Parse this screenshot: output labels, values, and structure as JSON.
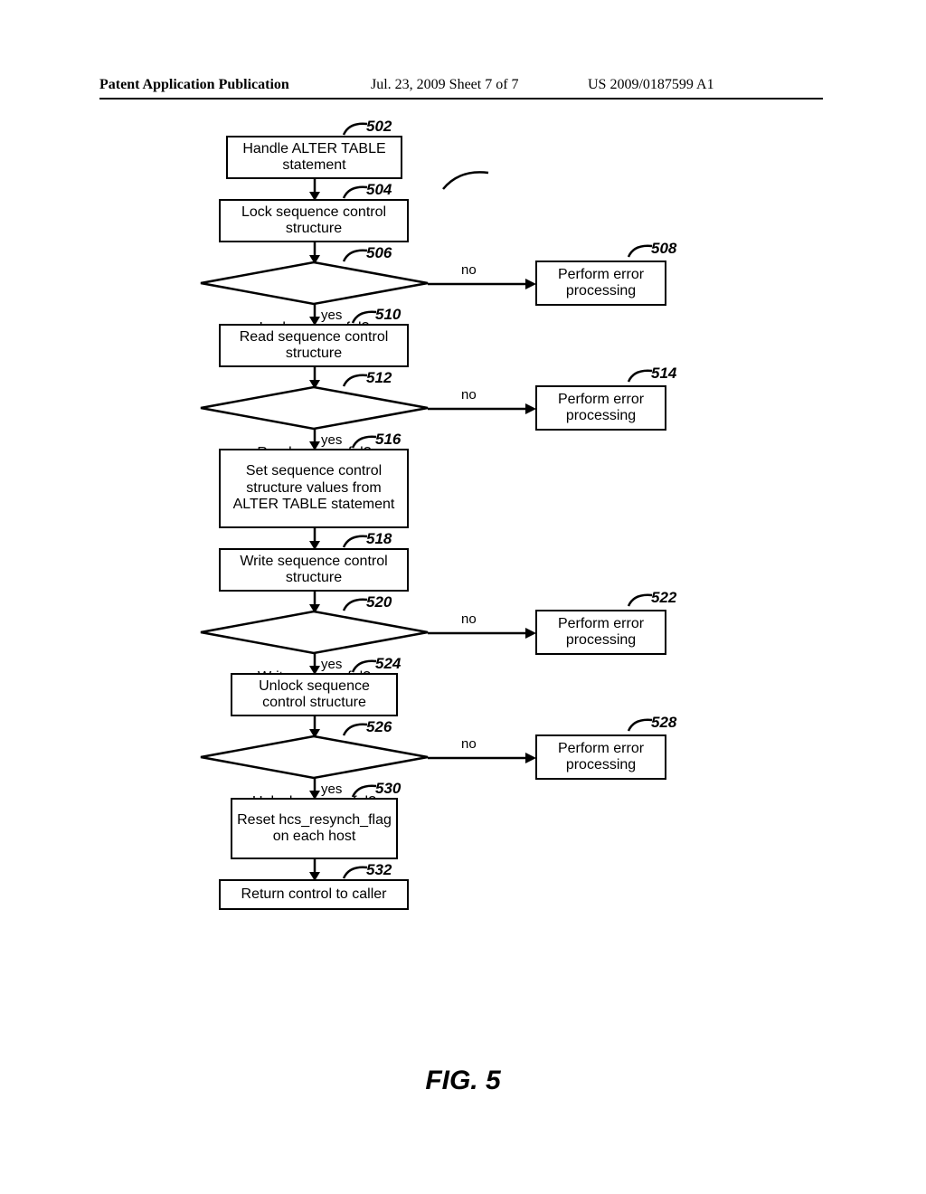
{
  "header": {
    "left": "Patent Application Publication",
    "middle": "Jul. 23, 2009   Sheet 7 of 7",
    "right": "US 2009/0187599 A1"
  },
  "figure_caption": "FIG. 5",
  "refs": {
    "r502": "502",
    "r504": "504",
    "r506": "506",
    "r508": "508",
    "r510": "510",
    "r512": "512",
    "r514": "514",
    "r516": "516",
    "r518": "518",
    "r520": "520",
    "r522": "522",
    "r524": "524",
    "r526": "526",
    "r528": "528",
    "r530": "530",
    "r532": "532"
  },
  "labels": {
    "yes": "yes",
    "no": "no"
  },
  "nodes": {
    "n502": "Handle ALTER TABLE statement",
    "n504": "Lock sequence control structure",
    "n506": "Lock successful?",
    "n508": "Perform error processing",
    "n510": "Read sequence control structure",
    "n512": "Read successful?",
    "n514": "Perform error processing",
    "n516": "Set sequence control structure values from ALTER TABLE statement",
    "n518": "Write sequence control structure",
    "n520": "Write successful?",
    "n522": "Perform error processing",
    "n524": "Unlock sequence control structure",
    "n526": "Unlock successful?",
    "n528": "Perform error processing",
    "n530": "Reset hcs_resynch_flag on each host",
    "n532": "Return control to caller"
  },
  "chart_data": {
    "type": "flowchart",
    "title": "FIG. 5",
    "nodes": [
      {
        "id": "502",
        "shape": "process",
        "text": "Handle ALTER TABLE statement"
      },
      {
        "id": "504",
        "shape": "process",
        "text": "Lock sequence control structure"
      },
      {
        "id": "506",
        "shape": "decision",
        "text": "Lock successful?"
      },
      {
        "id": "508",
        "shape": "process",
        "text": "Perform error processing"
      },
      {
        "id": "510",
        "shape": "process",
        "text": "Read sequence control structure"
      },
      {
        "id": "512",
        "shape": "decision",
        "text": "Read successful?"
      },
      {
        "id": "514",
        "shape": "process",
        "text": "Perform error processing"
      },
      {
        "id": "516",
        "shape": "process",
        "text": "Set sequence control structure values from ALTER TABLE statement"
      },
      {
        "id": "518",
        "shape": "process",
        "text": "Write sequence control structure"
      },
      {
        "id": "520",
        "shape": "decision",
        "text": "Write successful?"
      },
      {
        "id": "522",
        "shape": "process",
        "text": "Perform error processing"
      },
      {
        "id": "524",
        "shape": "process",
        "text": "Unlock sequence control structure"
      },
      {
        "id": "526",
        "shape": "decision",
        "text": "Unlock successful?"
      },
      {
        "id": "528",
        "shape": "process",
        "text": "Perform error processing"
      },
      {
        "id": "530",
        "shape": "process",
        "text": "Reset hcs_resynch_flag on each host"
      },
      {
        "id": "532",
        "shape": "process",
        "text": "Return control to caller"
      }
    ],
    "edges": [
      {
        "from": "502",
        "to": "504"
      },
      {
        "from": "504",
        "to": "506"
      },
      {
        "from": "506",
        "to": "510",
        "label": "yes"
      },
      {
        "from": "506",
        "to": "508",
        "label": "no"
      },
      {
        "from": "510",
        "to": "512"
      },
      {
        "from": "512",
        "to": "516",
        "label": "yes"
      },
      {
        "from": "512",
        "to": "514",
        "label": "no"
      },
      {
        "from": "516",
        "to": "518"
      },
      {
        "from": "518",
        "to": "520"
      },
      {
        "from": "520",
        "to": "524",
        "label": "yes"
      },
      {
        "from": "520",
        "to": "522",
        "label": "no"
      },
      {
        "from": "524",
        "to": "526"
      },
      {
        "from": "526",
        "to": "530",
        "label": "yes"
      },
      {
        "from": "526",
        "to": "528",
        "label": "no"
      },
      {
        "from": "530",
        "to": "532"
      }
    ]
  }
}
